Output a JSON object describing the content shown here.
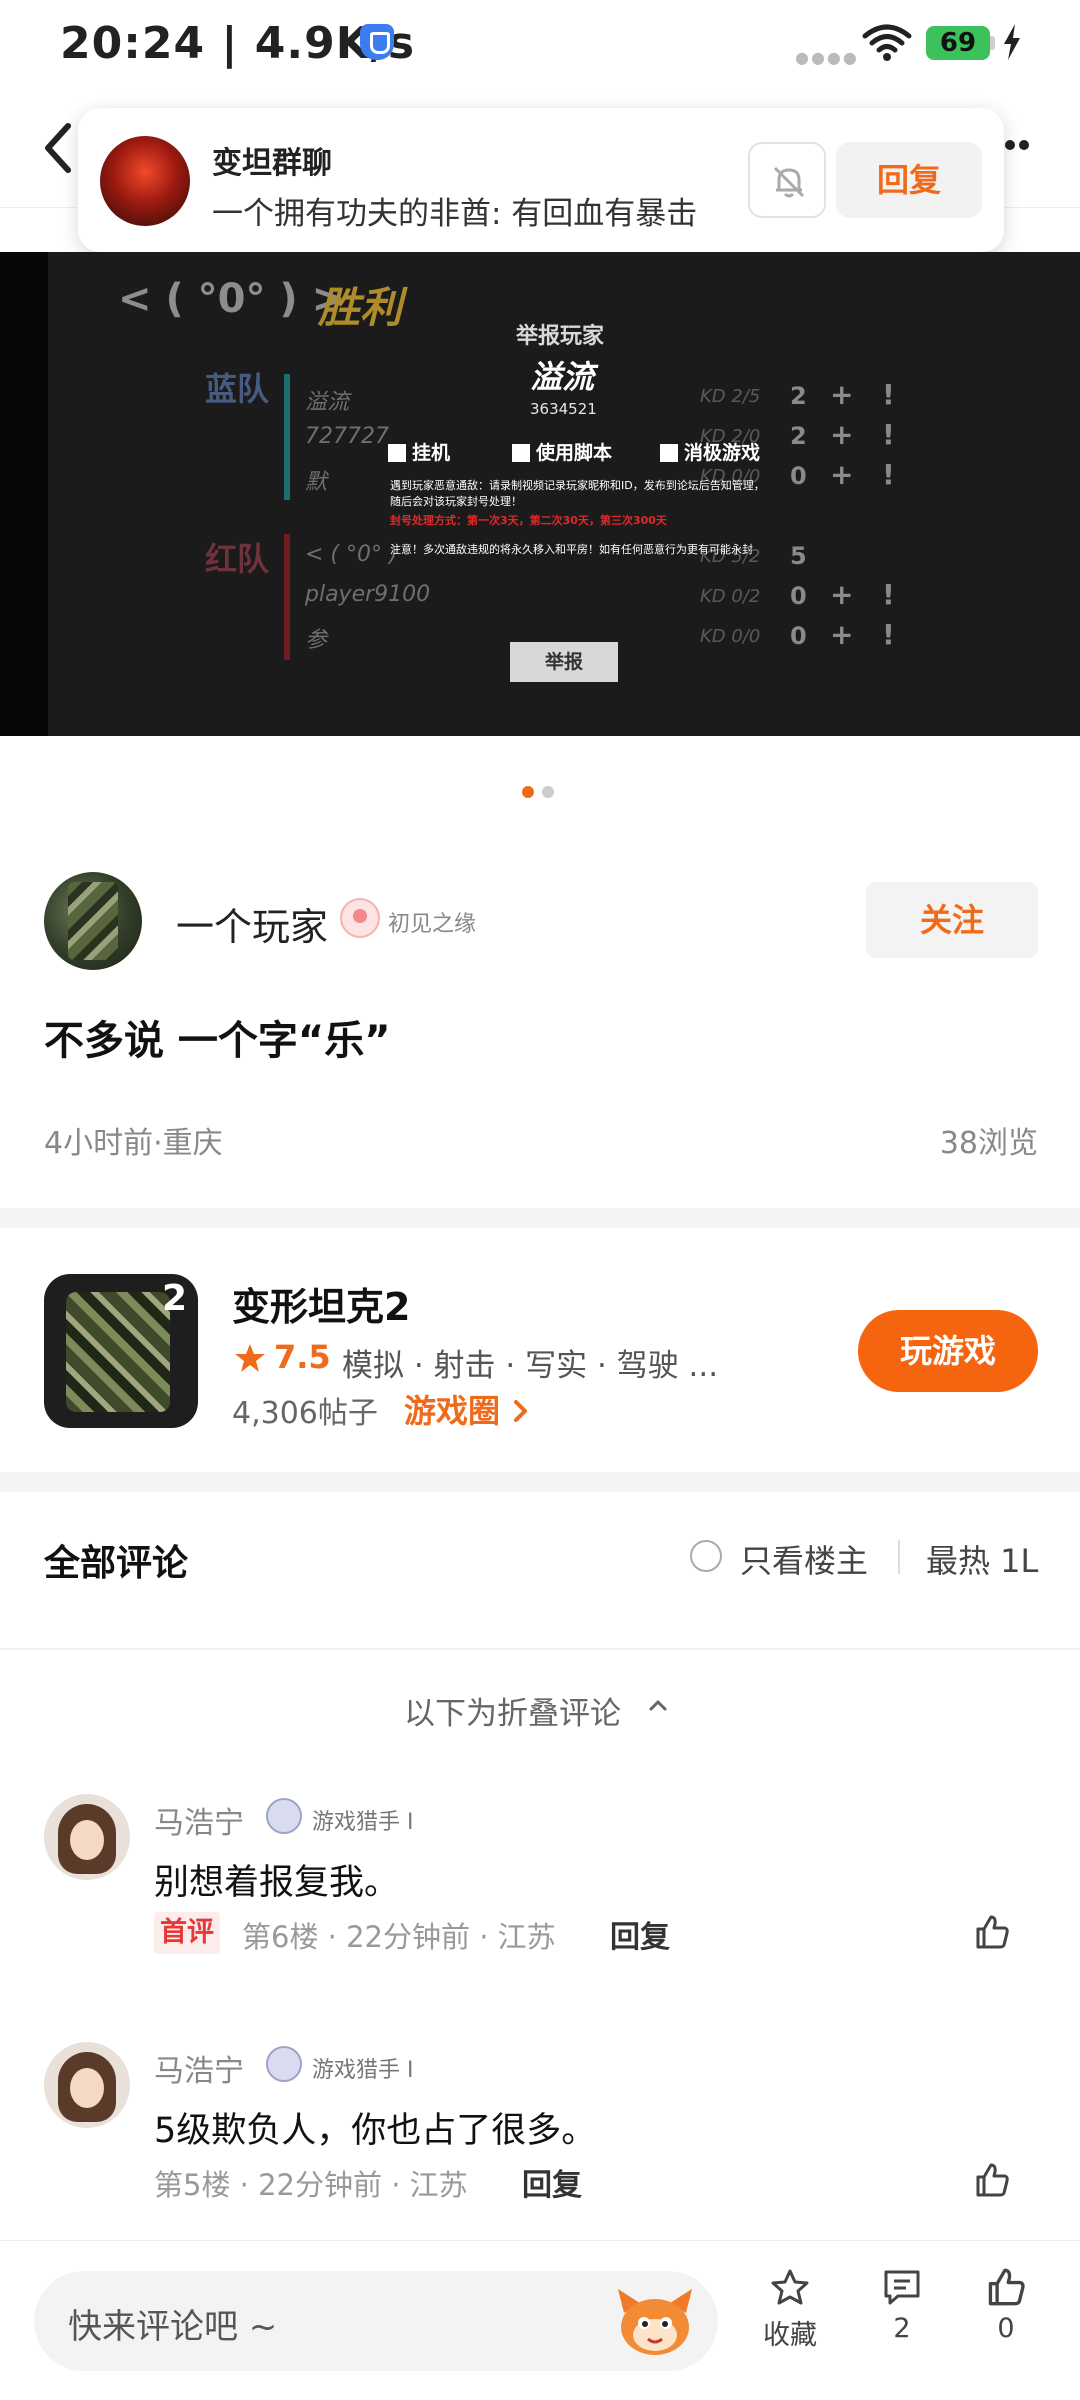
{
  "status_bar": {
    "time": "20:24 | 4.9K/s",
    "battery": "69"
  },
  "notification": {
    "title": "变坦群聊",
    "message": "一个拥有功夫的非酋: 有回血有暴击",
    "reply_label": "回复"
  },
  "banner": {
    "score": "< ( °0° ) >",
    "result": "胜利",
    "blue_team": "蓝队",
    "red_team": "红队",
    "blue_players": [
      "溢流",
      "727727",
      "默"
    ],
    "red_players": [
      "< ( °0° )",
      "player9100",
      "参"
    ],
    "blue_kd": [
      "KD 2/5",
      "KD 2/0",
      "KD 0/0"
    ],
    "red_kd": [
      "KD 5/2",
      "KD 0/2",
      "KD 0/0"
    ],
    "blue_nums": [
      "2",
      "2",
      "0"
    ],
    "red_nums": [
      "5",
      "0",
      "0"
    ],
    "report_title": "举报玩家",
    "report_name": "溢流",
    "report_id": "3634521",
    "options": [
      "挂机",
      "使用脚本",
      "消极游戏"
    ],
    "warn1": "遇到玩家恶意通敌：请录制视频记录玩家昵称和ID，发布到论坛后告知管理，随后会对该玩家封号处理！",
    "warn2": "封号处理方式：第一次3天，第二次30天，第三次300天",
    "warn3": "注意！多次通敌违规的将永久移入和平房！如有任何恶意行为更有可能永封",
    "report_button": "举报",
    "page_count": 2,
    "active_page": 1
  },
  "post": {
    "author": "一个玩家",
    "badge": "初见之缘",
    "follow_label": "关注",
    "title": "不多说 一个字“乐”",
    "meta": "4小时前·重庆",
    "views": "38浏览"
  },
  "game": {
    "name": "变形坦克2",
    "icon_number": "2",
    "rating": "7.5",
    "tags": "模拟 · 射击 · 写实 · 驾驶 ...",
    "posts": "4,306帖子",
    "circle_label": "游戏圈",
    "play_label": "玩游戏"
  },
  "comments_header": {
    "title": "全部评论",
    "only_op": "只看楼主",
    "sort": "最热 1L",
    "folded": "以下为折叠评论"
  },
  "comments": [
    {
      "name": "马浩宁",
      "badge": "游戏猎手 I",
      "text": "别想着报复我。",
      "first_tag": "首评",
      "meta": "第6楼 · 22分钟前 · 江苏",
      "reply": "回复"
    },
    {
      "name": "马浩宁",
      "badge": "游戏猎手 I",
      "text": "5级欺负人，你也占了很多。",
      "meta": "第5楼 · 22分钟前 · 江苏",
      "reply": "回复"
    }
  ],
  "bottom_bar": {
    "placeholder": "快来评论吧 ~",
    "favorite_label": "收藏",
    "comment_count": "2",
    "like_count": "0"
  },
  "colors": {
    "accent": "#f06a1c",
    "play_button": "#f5650f",
    "battery": "#3cc25c",
    "first_comment_tag": "#e53935"
  },
  "icons": [
    "back-icon",
    "more-icon",
    "bell-off-icon",
    "star-icon",
    "chevron-right-icon",
    "chevron-up-icon",
    "thumb-up-icon",
    "comment-icon",
    "mascot-icon",
    "wifi-icon",
    "shield-icon",
    "charge-icon"
  ]
}
